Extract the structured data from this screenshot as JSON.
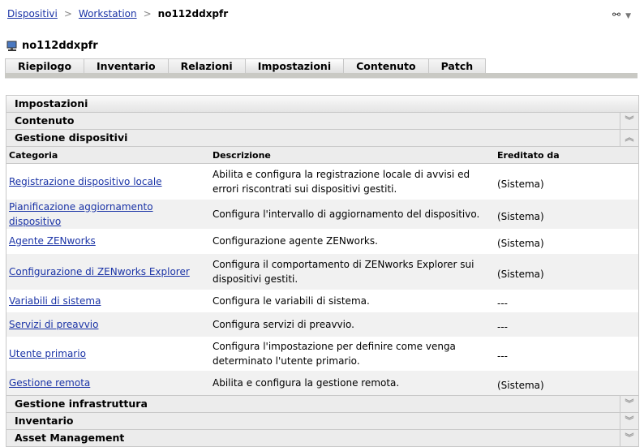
{
  "breadcrumb": {
    "items": [
      "Dispositivi",
      "Workstation"
    ],
    "current": "no112ddxpfr"
  },
  "toolbar": {
    "link_icon": "link-icon",
    "menu_icon": "dropdown-icon"
  },
  "title": "no112ddxpfr",
  "tabs": [
    "Riepilogo",
    "Inventario",
    "Relazioni",
    "Impostazioni",
    "Contenuto",
    "Patch"
  ],
  "active_tab": "Impostazioni",
  "panel": {
    "header": "Impostazioni",
    "sections_top": [
      "Contenuto",
      "Gestione dispositivi"
    ],
    "columns": [
      "Categoria",
      "Descrizione",
      "Ereditato da"
    ],
    "rows": [
      {
        "category": "Registrazione dispositivo locale",
        "description": "Abilita e configura la registrazione locale di avvisi ed errori riscontrati sui dispositivi gestiti.",
        "inherited": "(Sistema)"
      },
      {
        "category": "Pianificazione aggiornamento dispositivo",
        "description": "Configura l'intervallo di aggiornamento del dispositivo.",
        "inherited": "(Sistema)"
      },
      {
        "category": "Agente ZENworks",
        "description": "Configurazione agente ZENworks.",
        "inherited": "(Sistema)"
      },
      {
        "category": "Configurazione di ZENworks Explorer",
        "description": "Configura il comportamento di ZENworks Explorer sui dispositivi gestiti.",
        "inherited": "(Sistema)"
      },
      {
        "category": "Variabili di sistema",
        "description": "Configura le variabili di sistema.",
        "inherited": "---"
      },
      {
        "category": "Servizi di preavvio",
        "description": "Configura servizi di preavvio.",
        "inherited": "---"
      },
      {
        "category": "Utente primario",
        "description": "Configura l'impostazione per definire come venga determinato l'utente primario.",
        "inherited": "---"
      },
      {
        "category": "Gestione remota",
        "description": "Abilita e configura la gestione remota.",
        "inherited": "(Sistema)"
      }
    ],
    "sections_bottom": [
      "Gestione infrastruttura",
      "Inventario",
      "Asset Management"
    ],
    "expand_glyph": "︾",
    "collapse_glyph": "︽"
  }
}
